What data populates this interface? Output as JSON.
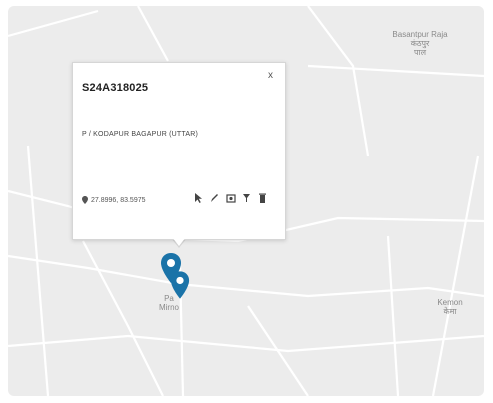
{
  "map": {
    "places": [
      {
        "name": "Basantpur Raja",
        "sub": "कंठपुर",
        "extra": "पाल"
      },
      {
        "name": "Kemon",
        "sub": "केमा"
      },
      {
        "name": "Pa",
        "sub": "Mirno"
      }
    ]
  },
  "popup": {
    "title": "S24A318025",
    "address": "P / KODAPUR BAGAPUR (UTTAR)",
    "coords": "27.8996, 83.5975",
    "close_label": "x",
    "actions": [
      {
        "icon": "cursor-icon"
      },
      {
        "icon": "edit-icon"
      },
      {
        "icon": "camera-icon"
      },
      {
        "icon": "filter-icon"
      },
      {
        "icon": "delete-icon"
      }
    ]
  },
  "colors": {
    "map_bg": "#ececec",
    "road": "#ffffff",
    "marker": "#1a73a8"
  }
}
